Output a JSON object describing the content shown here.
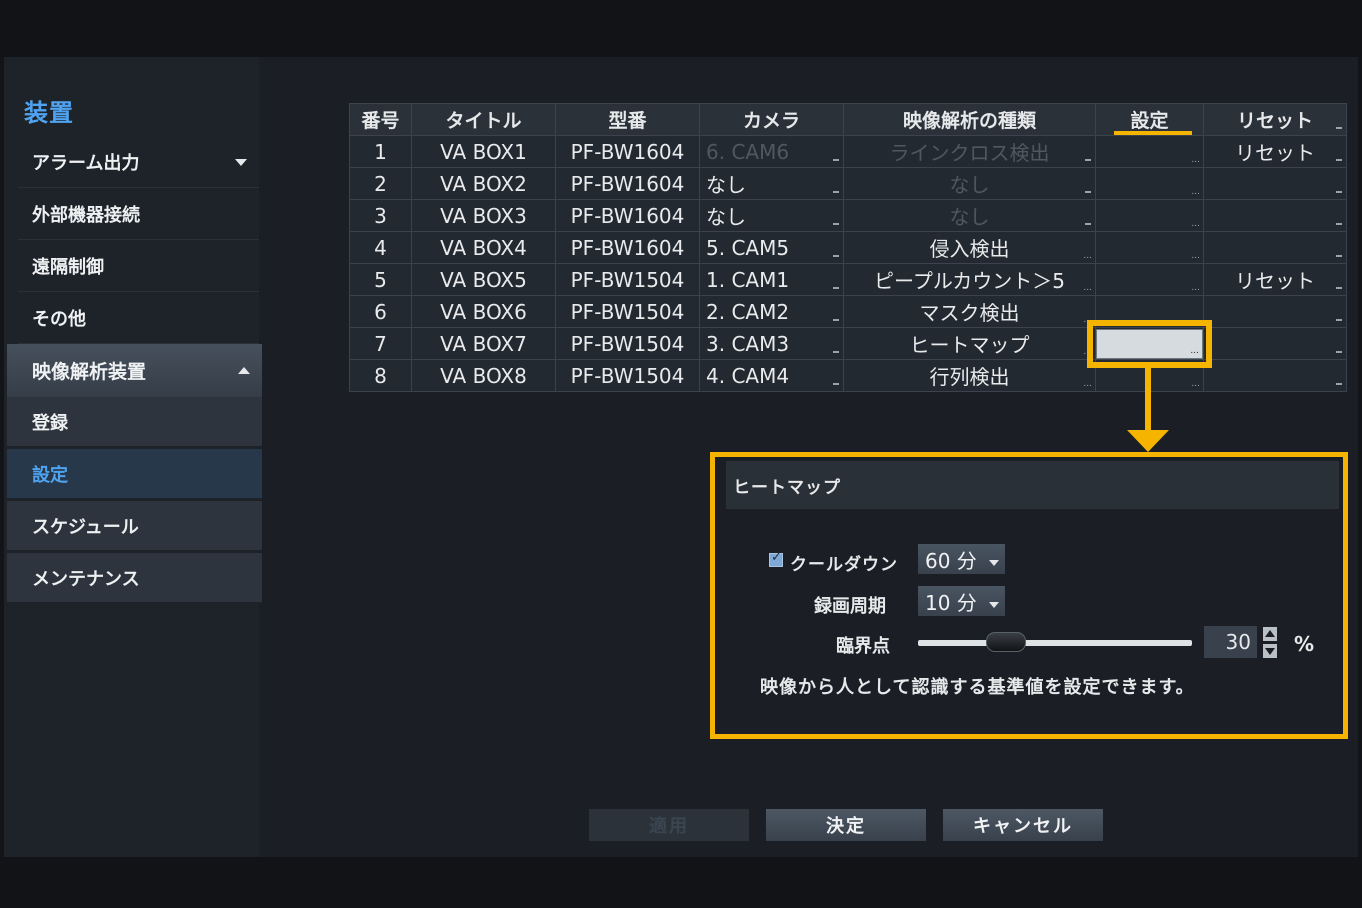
{
  "sidebar": {
    "title": "装置",
    "items": [
      {
        "label": "アラーム出力"
      },
      {
        "label": "外部機器接続"
      },
      {
        "label": "遠隔制御"
      },
      {
        "label": "その他"
      }
    ],
    "group": {
      "label": "映像解析装置"
    },
    "sub_items": [
      {
        "label": "登録"
      },
      {
        "label": "設定"
      },
      {
        "label": "スケジュール"
      },
      {
        "label": "メンテナンス"
      }
    ]
  },
  "table": {
    "headers": [
      "番号",
      "タイトル",
      "型番",
      "カメラ",
      "映像解析の種類",
      "設定",
      "リセット"
    ],
    "rows": [
      {
        "no": "1",
        "title": "VA BOX1",
        "model": "PF-BW1604",
        "camera": "6. CAM6",
        "analysis": "ラインクロス検出",
        "reset": "リセット"
      },
      {
        "no": "2",
        "title": "VA BOX2",
        "model": "PF-BW1604",
        "camera": "なし",
        "analysis": "なし",
        "reset": ""
      },
      {
        "no": "3",
        "title": "VA BOX3",
        "model": "PF-BW1604",
        "camera": "なし",
        "analysis": "なし",
        "reset": ""
      },
      {
        "no": "4",
        "title": "VA BOX4",
        "model": "PF-BW1604",
        "camera": "5. CAM5",
        "analysis": "侵入検出",
        "reset": ""
      },
      {
        "no": "5",
        "title": "VA BOX5",
        "model": "PF-BW1504",
        "camera": "1. CAM1",
        "analysis": "ピープルカウント＞5",
        "reset": "リセット"
      },
      {
        "no": "6",
        "title": "VA BOX6",
        "model": "PF-BW1504",
        "camera": "2. CAM2",
        "analysis": "マスク検出",
        "reset": ""
      },
      {
        "no": "7",
        "title": "VA BOX7",
        "model": "PF-BW1504",
        "camera": "3. CAM3",
        "analysis": "ヒートマップ",
        "reset": ""
      },
      {
        "no": "8",
        "title": "VA BOX8",
        "model": "PF-BW1504",
        "camera": "4. CAM4",
        "analysis": "行列検出",
        "reset": ""
      }
    ]
  },
  "popup": {
    "title": "ヒートマップ",
    "cooldown_label": "クールダウン",
    "cooldown_value": "60 分",
    "cooldown_checked": true,
    "cycle_label": "録画周期",
    "cycle_value": "10 分",
    "threshold_label": "臨界点",
    "threshold_value": "30",
    "threshold_unit": "%",
    "threshold_level": 0.32,
    "description": "映像から人として認識する基準値を設定できます。"
  },
  "buttons": {
    "apply": "適用",
    "ok": "決定",
    "cancel": "キャンセル"
  },
  "colors": {
    "accent": "#4fa3f0",
    "highlight": "#f5b400"
  }
}
